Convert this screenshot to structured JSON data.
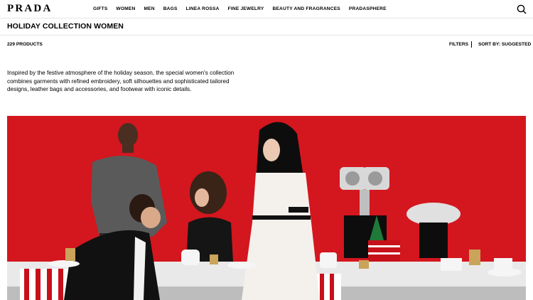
{
  "brand": {
    "logo": "PRADA"
  },
  "nav": {
    "items": [
      "GIFTS",
      "WOMEN",
      "MEN",
      "BAGS",
      "LINEA ROSSA",
      "FINE JEWELRY",
      "BEAUTY AND FRAGRANCES",
      "PRADASPHERE"
    ]
  },
  "header": {
    "search_icon": "search-icon"
  },
  "page": {
    "title": "HOLIDAY COLLECTION WOMEN",
    "product_count": "229 PRODUCTS",
    "filters_label": "FILTERS",
    "sort_label": "SORT BY: SUGGESTED",
    "description": "Inspired by the festive atmosphere of the holiday season, the special women's collection combines garments with refined embroidery, soft silhouettes and sophisticated tailored designs, leather bags and accessories, and footwear with iconic details."
  },
  "hero": {
    "background_color": "#d4161e"
  }
}
